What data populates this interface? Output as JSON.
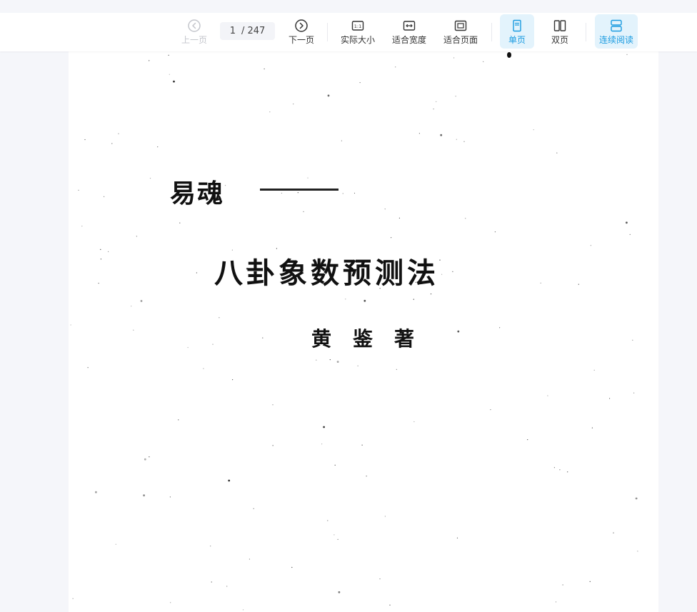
{
  "toolbar": {
    "prev_label": "上一页",
    "next_label": "下一页",
    "current_page": "1",
    "total_pages": "/ 247",
    "actual_size_label": "实际大小",
    "fit_width_label": "适合宽度",
    "fit_page_label": "适合页面",
    "single_page_label": "单页",
    "double_page_label": "双页",
    "continuous_label": "连续阅读",
    "accent_color": "#1a9be0",
    "active_bg": "#e3f3fc"
  },
  "document": {
    "series_title": "易魂",
    "main_title": "八卦象数预测法",
    "author": "黄鉴著"
  }
}
